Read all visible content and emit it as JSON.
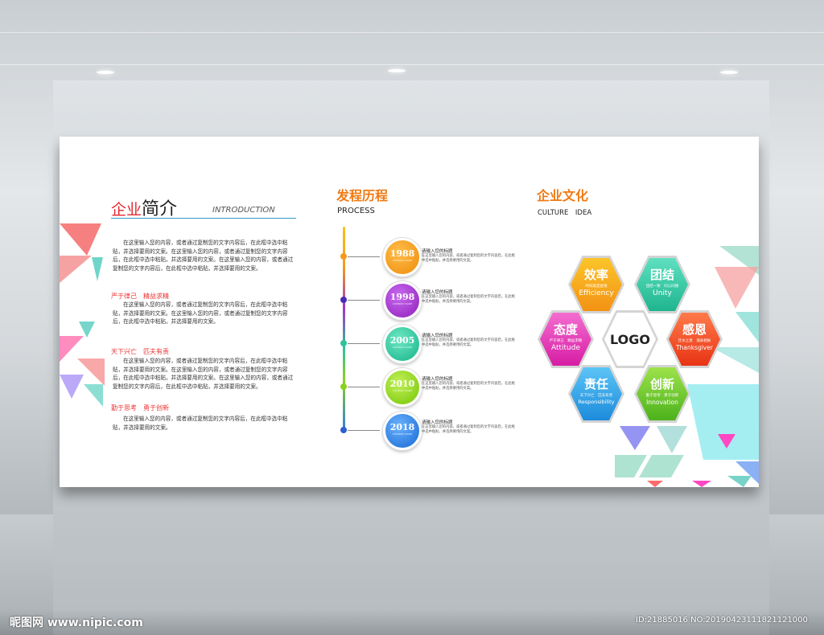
{
  "intro": {
    "title_red": "企业",
    "title_black": "简介",
    "title_en": "INTRODUCTION",
    "paragraphs": [
      "在这里输入您的内容，或者通过复制您的文字内容后，在此框中选中粘贴，并选择要用的文案。在这里输入您的内容，或者通过复制您的文字内容后，在此框中选中粘贴，并选择要用的文案。在这里输入您的内容，或者通过复制您的文字内容后，在此框中选中粘贴，并选择要用的文案。",
      "在这里输入您的内容，或者通过复制您的文字内容后，在此框中选中粘贴，并选择要用的文案。在这里输入您的内容，或者通过复制您的文字内容后，在此框中选中粘贴，并选择要用的文案。",
      "在这里输入您的内容，或者通过复制您的文字内容后，在此框中选中粘贴，并选择要用的文案。在这里输入您的内容，或者通过复制您的文字内容后，在此框中选中粘贴，并选择要用的文案。在这里输入您的内容，或者通过复制您的文字内容后，在此框中选中粘贴，并选择要用的文案。",
      "在这里输入您的内容，或者通过复制您的文字内容后，在此框中选中粘贴，并选择要用的文案。"
    ],
    "mottos": [
      "严于律己　精益求精",
      "天下兴亡　匹夫有责",
      "勤于思考　勇于创新"
    ]
  },
  "process": {
    "title": "发程历程",
    "subtitle": "PROCESS",
    "events": [
      {
        "year": "1988",
        "small": "COMPANY NAME",
        "title": "请输入您的标题",
        "text": "在这里输入您的内容，或者通过复制您的文字内容后，在此框中选中粘贴，并选择要用的文案。",
        "color": "#f39a1e"
      },
      {
        "year": "1998",
        "small": "COMPANY NAME",
        "title": "请输入您的标题",
        "text": "在这里输入您的内容，或者通过复制您的文字内容后，在此框中选中粘贴，并选择要用的文案。",
        "color": "#a035c9"
      },
      {
        "year": "2005",
        "small": "COMPANY NAME",
        "title": "请输入您的标题",
        "text": "在这里输入您的内容，或者通过复制您的文字内容后，在此框中选中粘贴，并选择要用的文案。",
        "color": "#2fc39a"
      },
      {
        "year": "2010",
        "small": "COMPANY NAME",
        "title": "请输入您的标题",
        "text": "在这里输入您的内容，或者通过复制您的文字内容后，在此框中选中粘贴，并选择要用的文案。",
        "color": "#8cd21d"
      },
      {
        "year": "2018",
        "small": "COMPANY NAME",
        "title": "请输入您的标题",
        "text": "在这里输入您的内容，或者通过复制您的文字内容后，在此框中选中粘贴，并选择要用的文案。",
        "color": "#2f7ee0"
      }
    ]
  },
  "culture": {
    "title": "企业文化",
    "subtitle": "CULTURE　IDEA",
    "logo": "LOGO",
    "values": [
      {
        "zh": "效率",
        "small": "时间就是金钱",
        "en": "Efficiency",
        "color": "#f7a51a"
      },
      {
        "zh": "团结",
        "small": "团结一致　同心同德",
        "en": "Unity",
        "color": "#26c8a2"
      },
      {
        "zh": "态度",
        "small": "严于律己　精益求精",
        "en": "Attitude",
        "color": "#e23ab7"
      },
      {
        "zh": "感恩",
        "small": "饮水之恩　涌泉相报",
        "en": "Thanksgiver",
        "color": "#f04e1e"
      },
      {
        "zh": "责任",
        "small": "天下兴亡　匹夫有责",
        "en": "Responsibility",
        "color": "#2ea3ea"
      },
      {
        "zh": "创新",
        "small": "勤于思考　勇于创新",
        "en": "Innovation",
        "color": "#6ac92a"
      }
    ]
  },
  "watermark": {
    "left": "昵图网 www.nipic.com",
    "right": "ID:21885016 NO:20190423111821121000"
  }
}
